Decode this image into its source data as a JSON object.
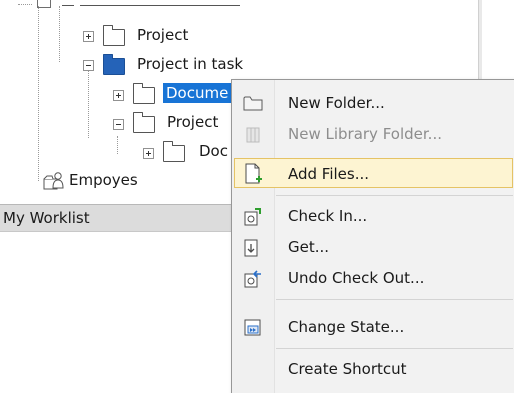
{
  "tree": {
    "items": [
      {
        "label": "Project",
        "expanded": false,
        "selected": false,
        "icon": "folder-icon"
      },
      {
        "label": "Project in task",
        "expanded": true,
        "selected": false,
        "icon": "folder-blue-icon"
      },
      {
        "label": "Docume",
        "expanded": false,
        "selected": true,
        "icon": "folder-icon"
      },
      {
        "label": "Project",
        "expanded": true,
        "selected": false,
        "icon": "folder-icon"
      },
      {
        "label": "Doc",
        "expanded": false,
        "selected": false,
        "icon": "folder-icon"
      },
      {
        "label": "Empoyes",
        "selected": false,
        "icon": "users-icon"
      }
    ]
  },
  "worklist": {
    "label": "My Worklist"
  },
  "context_menu": {
    "items": [
      {
        "label": "New Folder...",
        "icon": "new-folder-icon",
        "enabled": true
      },
      {
        "label": "New Library Folder...",
        "icon": "library-folder-icon",
        "enabled": false
      },
      {
        "label": "Add Files...",
        "icon": "add-file-icon",
        "enabled": true,
        "highlighted": true
      },
      {
        "label": "Check In...",
        "icon": "check-in-icon",
        "enabled": true
      },
      {
        "label": "Get...",
        "icon": "get-icon",
        "enabled": true
      },
      {
        "label": "Undo Check Out...",
        "icon": "undo-checkout-icon",
        "enabled": true
      },
      {
        "label": "Change State...",
        "icon": "change-state-icon",
        "enabled": true
      },
      {
        "label": "Create Shortcut",
        "icon": "shortcut-icon",
        "enabled": true
      }
    ]
  },
  "colors": {
    "selection": "#1874d6",
    "menu_highlight": "#fdf4d2",
    "menu_highlight_border": "#e5c365",
    "header_bg": "#dcdcdc"
  }
}
